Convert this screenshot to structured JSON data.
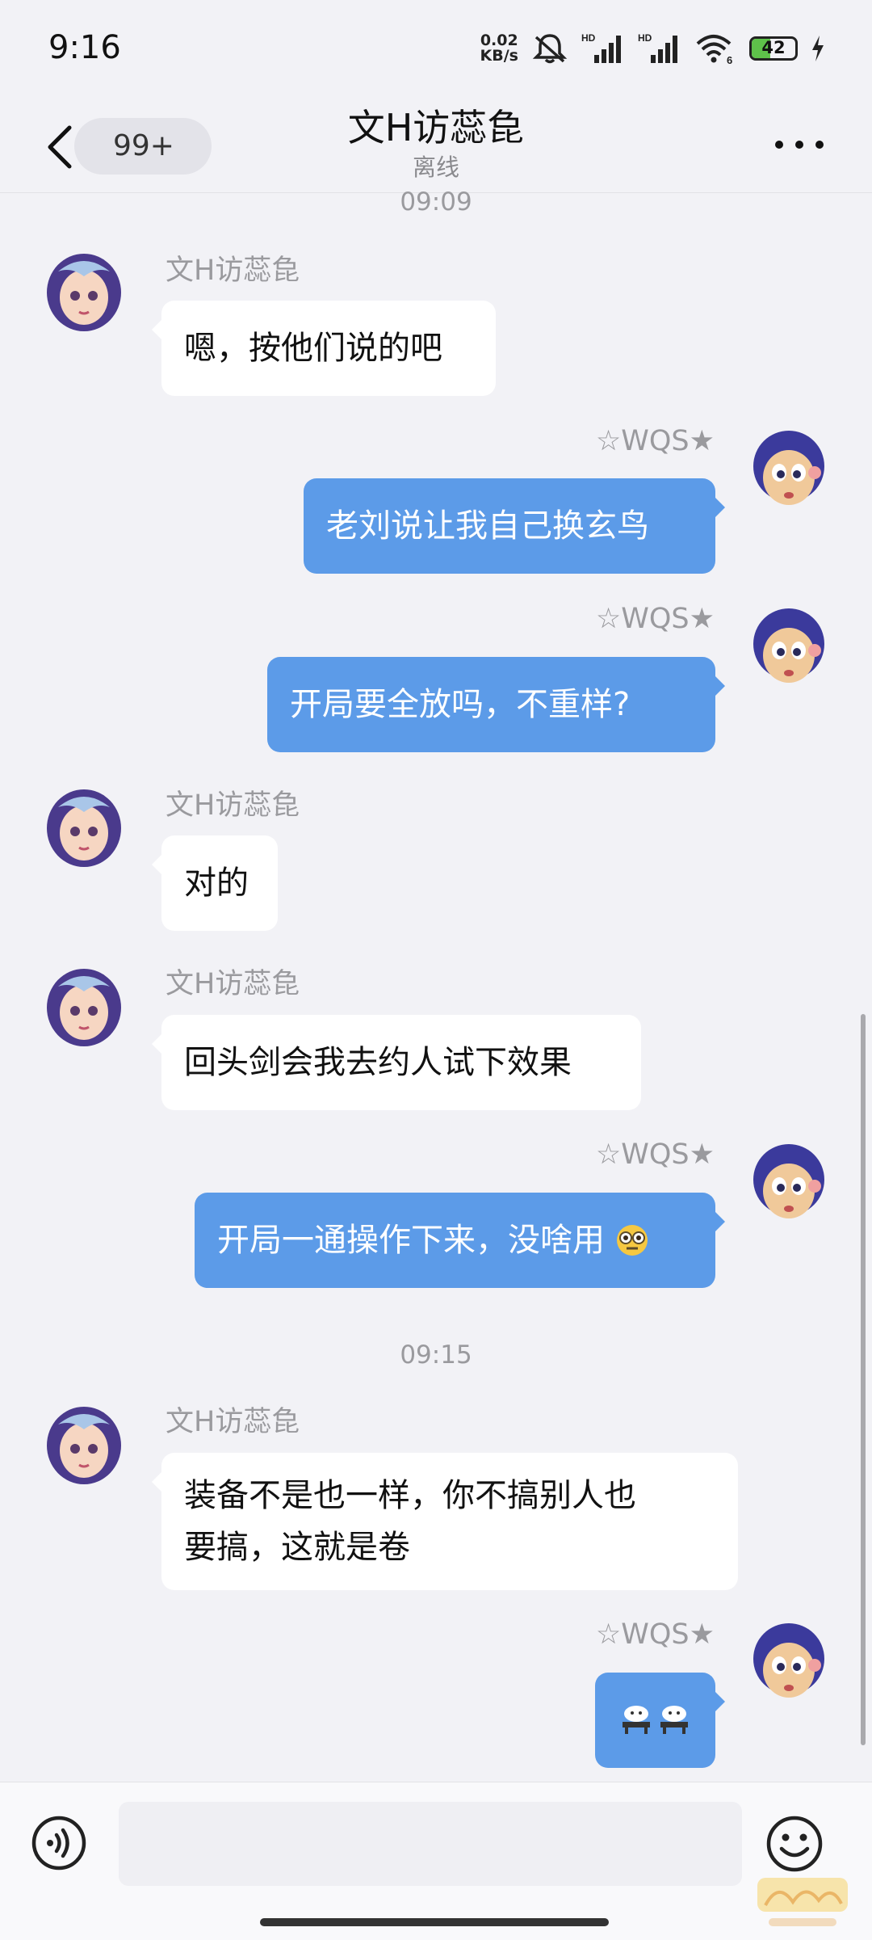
{
  "status_bar": {
    "time": "9:16",
    "net_speed_value": "0.02",
    "net_speed_unit": "KB/s",
    "signal1_label": "HD",
    "signal2_label": "HD",
    "wifi_label": "6",
    "battery_level": "42",
    "battery_fraction": 0.42
  },
  "header": {
    "back_badge": "99+",
    "title": "文H访蕊㲋",
    "subtitle": "离线"
  },
  "messages": {
    "ts1": "09:09",
    "m1_name": "文H访蕊㲋",
    "m1_text": "嗯，按他们说的吧",
    "m2_name": "☆WQS★",
    "m2_text": "老刘说让我自己换玄鸟",
    "m3_name": "☆WQS★",
    "m3_text": "开局要全放吗，不重样?",
    "m4_name": "文H访蕊㲋",
    "m4_text": "对的",
    "m5_name": "文H访蕊㲋",
    "m5_text": "回头剑会我去约人试下效果",
    "m6_name": "☆WQS★",
    "m6_text": "开局一通操作下来，没啥用",
    "ts2": "09:15",
    "m7_name": "文H访蕊㲋",
    "m7_line1": "装备不是也一样，你不搞别人也",
    "m7_line2": "要搞，这就是卷",
    "m8_name": "☆WQS★"
  },
  "icons": {
    "voice": "voice-icon",
    "emoji": "smiley-face-icon",
    "back": "chevron-left-icon",
    "more": "more-dots-icon"
  },
  "colors": {
    "outgoing_bubble": "#5c9be8",
    "incoming_bubble": "#ffffff",
    "background": "#f2f2f6"
  }
}
